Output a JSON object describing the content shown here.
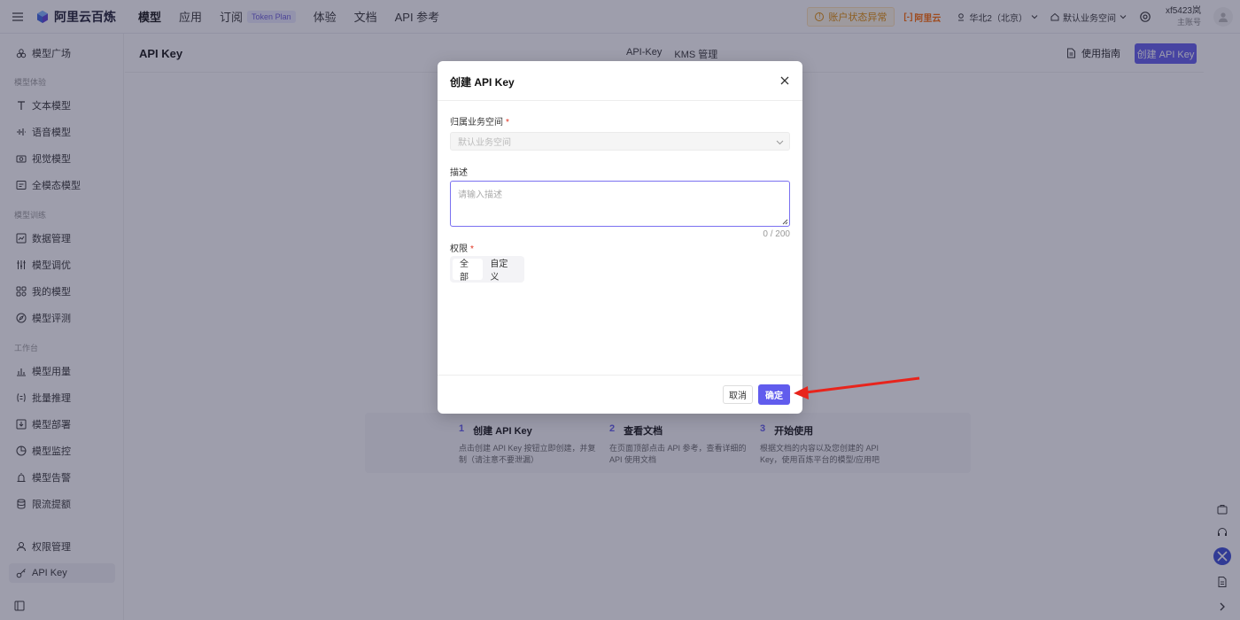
{
  "topbar": {
    "logo_text": "阿里云百炼",
    "nav": [
      {
        "label": "模型",
        "active": true
      },
      {
        "label": "应用"
      },
      {
        "label": "订阅",
        "tag": "Token Plan"
      },
      {
        "label": "体验"
      },
      {
        "label": "文档"
      },
      {
        "label": "API 参考"
      }
    ],
    "alert_text": "账户状态异常",
    "aliyun_text": "阿里云",
    "region_text": "华北2（北京）",
    "workspace_text": "默认业务空间",
    "user_name": "xf5423岚",
    "user_role": "主账号"
  },
  "sidebar": {
    "items": [
      {
        "label": "模型广场",
        "icon": "plaza-icon"
      },
      {
        "label": "文本模型",
        "icon": "text-icon"
      },
      {
        "label": "语音模型",
        "icon": "voice-icon"
      },
      {
        "label": "视觉模型",
        "icon": "camera-icon"
      },
      {
        "label": "全模态模型",
        "icon": "omni-icon"
      },
      {
        "label": "数据管理",
        "icon": "chart-line-icon"
      },
      {
        "label": "模型调优",
        "icon": "sliders-icon"
      },
      {
        "label": "我的模型",
        "icon": "grid-icon"
      },
      {
        "label": "模型评测",
        "icon": "compass-icon"
      },
      {
        "label": "模型用量",
        "icon": "bar-chart-icon"
      },
      {
        "label": "批量推理",
        "icon": "list-icon"
      },
      {
        "label": "模型部署",
        "icon": "deploy-icon"
      },
      {
        "label": "模型监控",
        "icon": "pie-icon"
      },
      {
        "label": "模型告警",
        "icon": "alarm-icon"
      },
      {
        "label": "限流提额",
        "icon": "database-icon"
      },
      {
        "label": "权限管理",
        "icon": "user-icon"
      },
      {
        "label": "API Key",
        "icon": "key-icon",
        "active": true
      }
    ],
    "groups": [
      "模型体验",
      "模型训练",
      "工作台"
    ]
  },
  "page": {
    "title": "API Key",
    "tabs": [
      "API-Key",
      "KMS 管理"
    ],
    "guide_label": "使用指南",
    "create_label": "创建 API Key"
  },
  "steps": [
    {
      "num": "1",
      "title": "创建 API Key",
      "desc": "点击创建 API Key 按钮立即创建，并复制（请注意不要泄漏）"
    },
    {
      "num": "2",
      "title": "查看文档",
      "desc": "在页面顶部点击 API 参考，查看详细的 API 使用文档"
    },
    {
      "num": "3",
      "title": "开始使用",
      "desc": "根据文档的内容以及您创建的 API Key，使用百炼平台的模型/应用吧"
    }
  ],
  "modal": {
    "title": "创建 API Key",
    "workspace_label": "归属业务空间",
    "workspace_value": "默认业务空间",
    "desc_label": "描述",
    "desc_placeholder": "请输入描述",
    "counter": "0 / 200",
    "perm_label": "权限",
    "perm_options": [
      "全部",
      "自定义"
    ],
    "perm_selected": "全部",
    "cancel_label": "取消",
    "ok_label": "确定",
    "required_mark": "*"
  },
  "colors": {
    "primary": "#615ced",
    "alert": "#e08a00",
    "annotation_arrow": "#e8241c"
  }
}
